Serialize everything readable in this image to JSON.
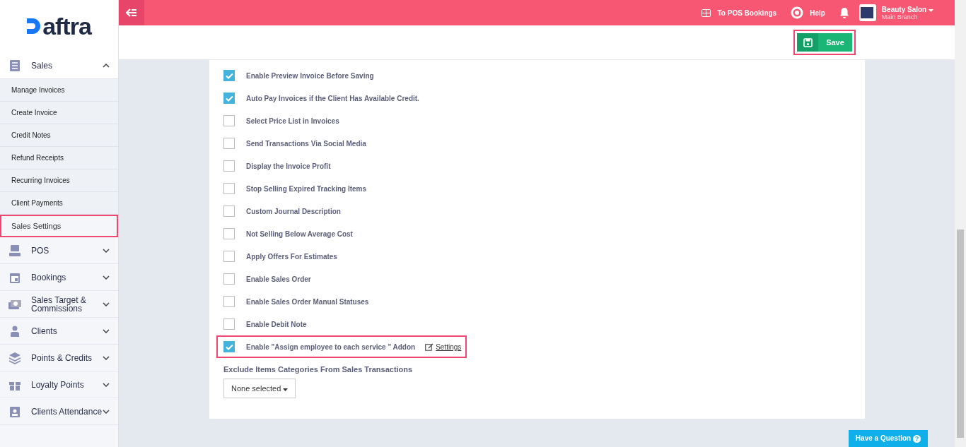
{
  "logo": {
    "text": "aftra"
  },
  "sidebar": {
    "items": [
      {
        "label": "Sales",
        "expanded": true,
        "children": [
          {
            "label": "Manage Invoices",
            "selected": false,
            "highlighted": false
          },
          {
            "label": "Create Invoice",
            "selected": false,
            "highlighted": false
          },
          {
            "label": "Credit Notes",
            "selected": false,
            "highlighted": false
          },
          {
            "label": "Refund Receipts",
            "selected": false,
            "highlighted": false
          },
          {
            "label": "Recurring Invoices",
            "selected": false,
            "highlighted": false
          },
          {
            "label": "Client Payments",
            "selected": false,
            "highlighted": false
          },
          {
            "label": "Sales Settings",
            "selected": true,
            "highlighted": true
          }
        ]
      },
      {
        "label": "POS",
        "expanded": false
      },
      {
        "label": "Bookings",
        "expanded": false
      },
      {
        "label": "Sales Target & Commissions",
        "expanded": false
      },
      {
        "label": "Clients",
        "expanded": false
      },
      {
        "label": "Points & Credits",
        "expanded": false
      },
      {
        "label": "Loyalty Points",
        "expanded": false
      },
      {
        "label": "Clients Attendance",
        "expanded": false
      }
    ]
  },
  "topbar": {
    "pos_link": "To POS Bookings",
    "help": "Help",
    "account": {
      "name": "Beauty Salon",
      "branch": "Main Branch"
    }
  },
  "save_button": {
    "label": "Save",
    "highlighted": true
  },
  "settings": [
    {
      "label": "Enable Preview Invoice Before Saving",
      "checked": true,
      "highlighted": false
    },
    {
      "label": "Auto Pay Invoices if the Client Has Available Credit.",
      "checked": true,
      "highlighted": false
    },
    {
      "label": "Select Price List in Invoices",
      "checked": false,
      "highlighted": false
    },
    {
      "label": "Send Transactions Via Social Media",
      "checked": false,
      "highlighted": false
    },
    {
      "label": "Display the Invoice Profit",
      "checked": false,
      "highlighted": false
    },
    {
      "label": "Stop Selling Expired Tracking Items",
      "checked": false,
      "highlighted": false
    },
    {
      "label": "Custom Journal Description",
      "checked": false,
      "highlighted": false
    },
    {
      "label": "Not Selling Below Average Cost",
      "checked": false,
      "highlighted": false
    },
    {
      "label": "Apply Offers For Estimates",
      "checked": false,
      "highlighted": false
    },
    {
      "label": "Enable Sales Order",
      "checked": false,
      "highlighted": false
    },
    {
      "label": "Enable Sales Order Manual Statuses",
      "checked": false,
      "highlighted": false
    },
    {
      "label": "Enable Debit Note",
      "checked": false,
      "highlighted": false
    },
    {
      "label": "Enable \"Assign employee to each service \" Addon",
      "checked": true,
      "highlighted": true,
      "link": "Settings"
    }
  ],
  "exclude": {
    "label": "Exclude Items Categories From Sales Transactions",
    "value": "None selected"
  },
  "help_button": {
    "label": "Have a Question",
    "icon": "?"
  }
}
